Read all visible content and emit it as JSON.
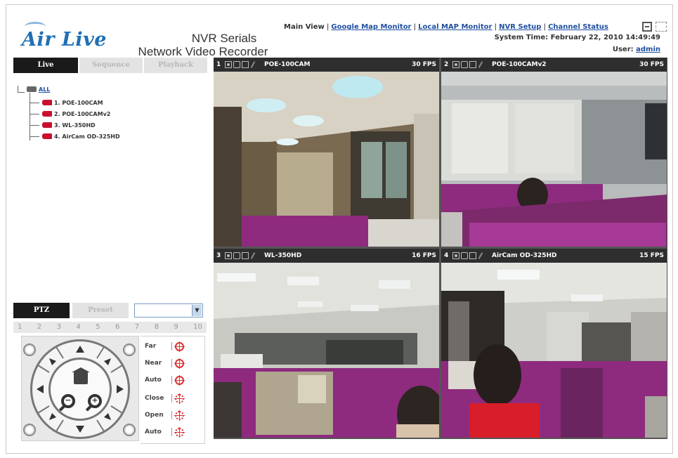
{
  "header": {
    "logo_text": "Air Live",
    "product_line1": "NVR Serials",
    "product_line2": "Network Video Recorder",
    "nav": [
      {
        "label": "Main View",
        "link": false
      },
      {
        "label": "Google Map Monitor",
        "link": true
      },
      {
        "label": "Local MAP Monitor",
        "link": true
      },
      {
        "label": "NVR Setup",
        "link": true
      },
      {
        "label": "Channel Status",
        "link": true
      }
    ],
    "system_time_label": "System Time: February 22, 2010 14:49:49",
    "user_label": "User:",
    "user_name": "admin"
  },
  "left_tabs": [
    {
      "label": "Live",
      "active": true
    },
    {
      "label": "Sequence",
      "active": false
    },
    {
      "label": "Playback",
      "active": false
    }
  ],
  "tree": {
    "root_label": "ALL",
    "items": [
      "1. POE-100CAM",
      "2. POE-100CAMv2",
      "3. WL-350HD",
      "4. AirCam OD-325HD"
    ]
  },
  "ptz": {
    "tab_ptz": "PTZ",
    "tab_preset": "Preset",
    "preset_value": "",
    "speeds": [
      "1",
      "2",
      "3",
      "4",
      "5",
      "6",
      "7",
      "8",
      "9",
      "10"
    ],
    "controls": [
      {
        "label": "Far",
        "icon": "focus-far-icon"
      },
      {
        "label": "Near",
        "icon": "focus-near-icon"
      },
      {
        "label": "Auto",
        "icon": "focus-auto-icon"
      },
      {
        "label": "Close",
        "icon": "iris-close-icon"
      },
      {
        "label": "Open",
        "icon": "iris-open-icon"
      },
      {
        "label": "Auto",
        "icon": "iris-auto-icon"
      }
    ]
  },
  "cameras": [
    {
      "num": "1",
      "name": "POE-100CAM",
      "fps": "30 FPS"
    },
    {
      "num": "2",
      "name": "POE-100CAMv2",
      "fps": "30 FPS"
    },
    {
      "num": "3",
      "name": "WL-350HD",
      "fps": "16 FPS"
    },
    {
      "num": "4",
      "name": "AirCam OD-325HD",
      "fps": "15 FPS"
    }
  ],
  "colors": {
    "brand_blue": "#1f6fb5",
    "link_blue": "#1f4fa0",
    "camera_red": "#c8102e",
    "office_purple": "#8e2b7e"
  }
}
